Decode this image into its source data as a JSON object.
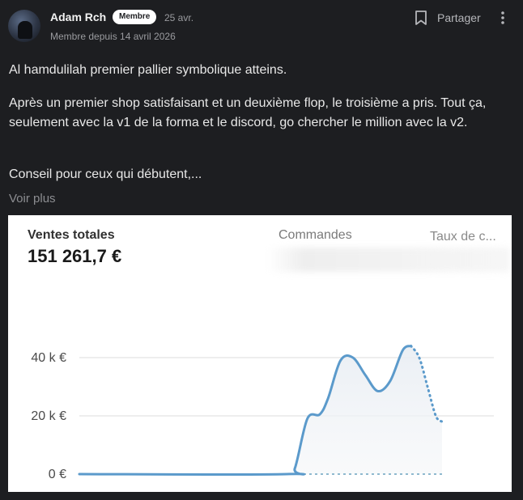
{
  "post": {
    "author": "Adam Rch",
    "badge": "Membre",
    "date": "25 avr.",
    "member_since": "Membre depuis 14 avril 2026",
    "share_label": "Partager",
    "paragraphs": [
      "Al hamdulilah premier pallier symbolique atteins.",
      "Après un premier shop satisfaisant et un deuxième flop, le troisième a pris. Tout ça, seulement avec la v1 de la forma et le discord, go chercher le million avec la v2.",
      "Conseil pour ceux qui débutent,..."
    ],
    "see_more": "Voir plus",
    "icons": {
      "bookmark": "bookmark-icon",
      "more": "more-vertical-icon",
      "avatar": "avatar-photo"
    }
  },
  "chart_card": {
    "metrics": [
      {
        "label": "Ventes totales",
        "value": "151 261,7 €"
      },
      {
        "label": "Commandes"
      },
      {
        "label": "Taux de c..."
      }
    ]
  },
  "chart_data": {
    "type": "line",
    "ytick_labels": [
      "0 €",
      "20 k €",
      "40 k €"
    ],
    "ylim": [
      0,
      50000
    ],
    "grid": true,
    "line_color": "#5b9acb",
    "comparison_color": "#8fb9cf",
    "series": [
      {
        "style": "solid",
        "points": [
          [
            0,
            0
          ],
          [
            0.5,
            0
          ],
          [
            0.52,
            2000
          ],
          [
            0.55,
            19000
          ],
          [
            0.58,
            20500
          ],
          [
            0.6,
            26000
          ],
          [
            0.63,
            39000
          ],
          [
            0.66,
            40000
          ],
          [
            0.69,
            34000
          ],
          [
            0.72,
            28500
          ],
          [
            0.75,
            32000
          ],
          [
            0.78,
            42500
          ],
          [
            0.8,
            44000
          ]
        ]
      },
      {
        "style": "dotted",
        "points": [
          [
            0.8,
            44000
          ],
          [
            0.82,
            40000
          ],
          [
            0.84,
            30000
          ],
          [
            0.86,
            20000
          ],
          [
            0.875,
            18000
          ]
        ]
      },
      {
        "style": "dashed",
        "points": [
          [
            0.5,
            0
          ],
          [
            0.875,
            0
          ]
        ]
      }
    ]
  }
}
